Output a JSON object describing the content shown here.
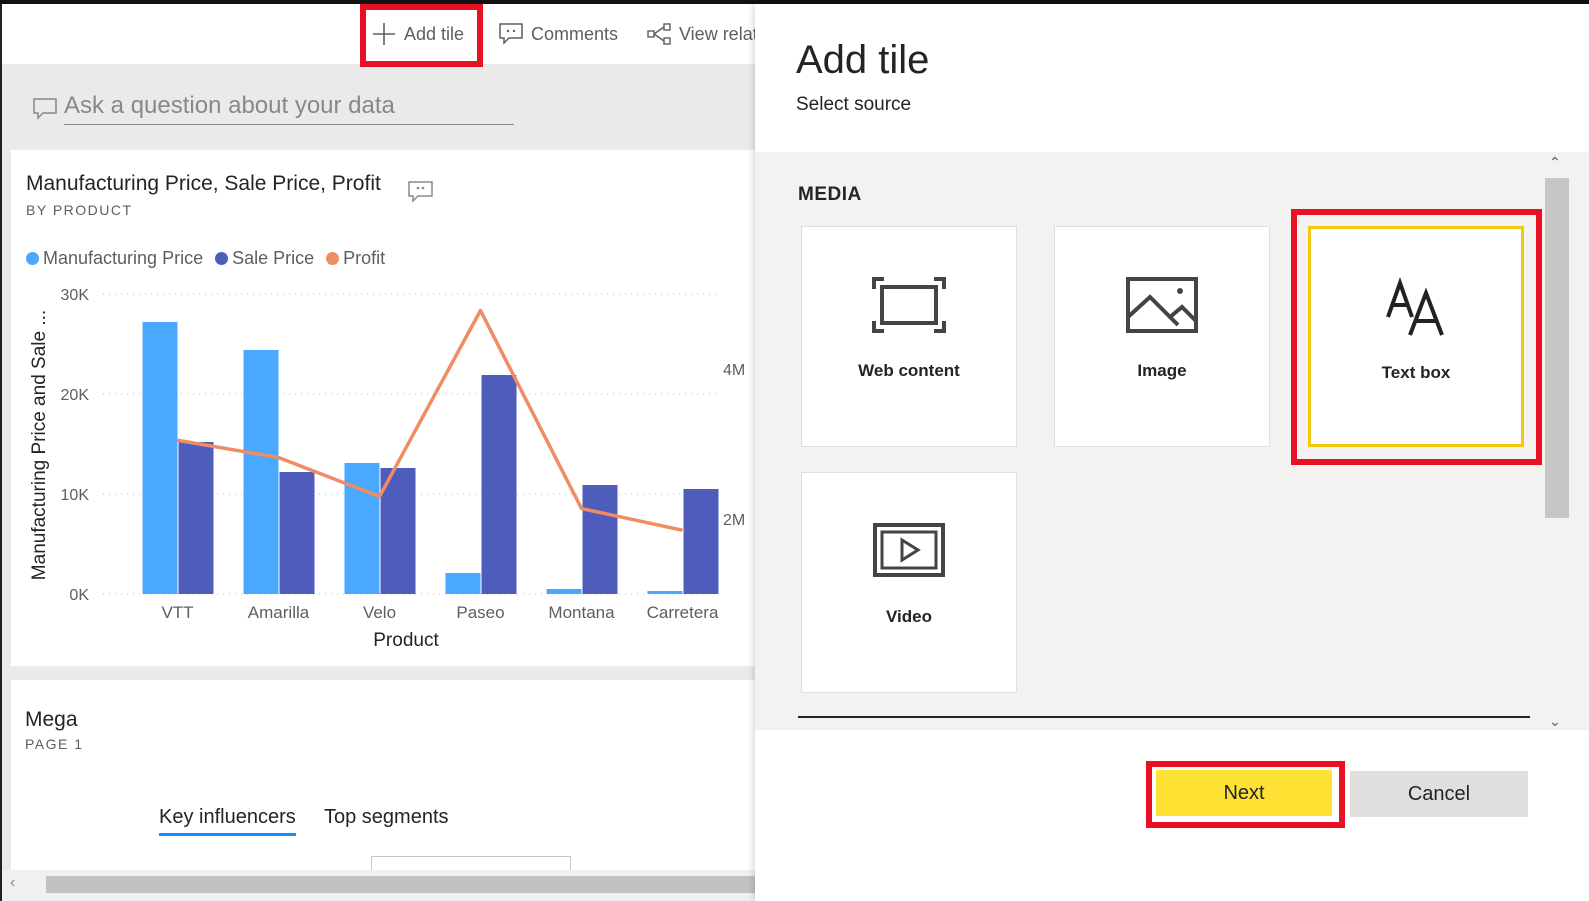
{
  "toolbar": {
    "add_tile_label": "Add tile",
    "comments_label": "Comments",
    "view_related_label": "View relat"
  },
  "qa": {
    "placeholder": "Ask a question about your data"
  },
  "tile1": {
    "title": "Manufacturing Price, Sale Price, Profit",
    "subtitle": "BY PRODUCT"
  },
  "chart_data": {
    "type": "bar",
    "categories": [
      "VTT",
      "Amarilla",
      "Velo",
      "Paseo",
      "Montana",
      "Carretera"
    ],
    "series": [
      {
        "name": "Manufacturing Price",
        "type": "bar",
        "axis": "left",
        "color": "#4aa8ff",
        "values": [
          27200,
          24400,
          13100,
          2100,
          500,
          300
        ]
      },
      {
        "name": "Sale Price",
        "type": "bar",
        "axis": "left",
        "color": "#4e5cbc",
        "values": [
          15200,
          12200,
          12600,
          21900,
          10900,
          10500
        ]
      },
      {
        "name": "Profit",
        "type": "line",
        "axis": "right",
        "color": "#f08c64",
        "values": [
          3050000,
          2820000,
          2300000,
          4780000,
          2140000,
          1850000
        ]
      }
    ],
    "xlabel": "Product",
    "ylabel": "Manufacturing Price and Sale ...",
    "ylim": [
      0,
      30000
    ],
    "y_ticks": [
      "0K",
      "10K",
      "20K",
      "30K"
    ],
    "y_tick_values": [
      0,
      10000,
      20000,
      30000
    ],
    "y2_ticks": [
      "2M",
      "4M"
    ],
    "y2_tick_values": [
      2000000,
      4000000
    ],
    "y2lim": [
      1000000,
      5000000
    ],
    "legend_position": "top-left",
    "grid": true
  },
  "tile2": {
    "title": "Mega",
    "subtitle": "PAGE 1",
    "tabs": [
      "Key influencers",
      "Top segments"
    ]
  },
  "pane": {
    "title": "Add tile",
    "subtitle": "Select source",
    "section": "MEDIA",
    "cards": [
      {
        "label": "Web content",
        "icon": "web-content-icon"
      },
      {
        "label": "Image",
        "icon": "image-icon"
      },
      {
        "label": "Text box",
        "icon": "text-box-icon"
      },
      {
        "label": "Video",
        "icon": "video-icon"
      }
    ],
    "next_label": "Next",
    "cancel_label": "Cancel"
  },
  "colors": {
    "highlight_red": "#e81123",
    "accent_yellow": "#fde234",
    "selected_border": "#f2c811"
  }
}
